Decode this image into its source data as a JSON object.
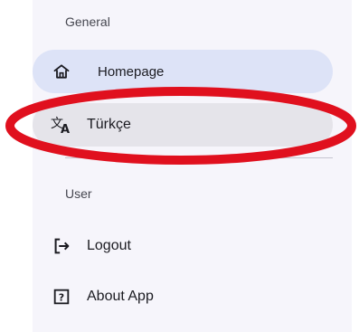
{
  "drawer": {
    "sections": [
      {
        "title": "General",
        "items": [
          {
            "label": "Homepage",
            "icon": "home-icon",
            "state": "selected"
          },
          {
            "label": "Türkçe",
            "icon": "translate-icon",
            "state": "highlighted"
          }
        ]
      },
      {
        "title": "User",
        "items": [
          {
            "label": "Logout",
            "icon": "logout-icon"
          },
          {
            "label": "About App",
            "icon": "help-box-icon"
          }
        ]
      }
    ]
  },
  "annotation": {
    "shape": "ellipse",
    "color": "#e0101e",
    "target": "Türkçe"
  },
  "colors": {
    "drawer_bg": "#f6f5fb",
    "selected_bg": "#dde3f7",
    "highlight_bg": "#e5e4ea"
  }
}
